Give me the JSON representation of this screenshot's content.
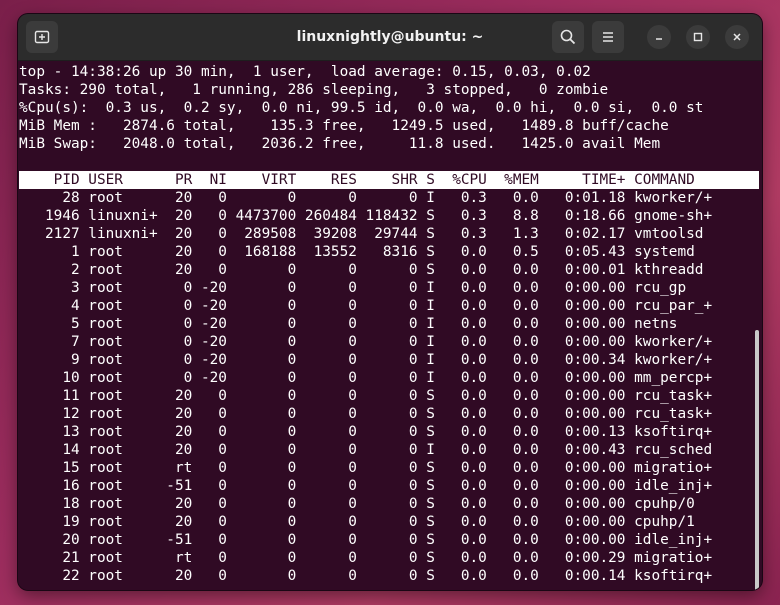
{
  "window": {
    "title": "linuxnightly@ubuntu: ~",
    "icons": {
      "new_tab": "new-tab-icon",
      "search": "search-icon",
      "menu": "hamburger-menu-icon",
      "minimize": "minimize-icon",
      "maximize": "maximize-icon",
      "close": "close-icon"
    }
  },
  "summary": {
    "line1": "top - 14:38:26 up 30 min,  1 user,  load average: 0.15, 0.03, 0.02",
    "line2": "Tasks: 290 total,   1 running, 286 sleeping,   3 stopped,   0 zombie",
    "line3": "%Cpu(s):  0.3 us,  0.2 sy,  0.0 ni, 99.5 id,  0.0 wa,  0.0 hi,  0.0 si,  0.0 st",
    "line4": "MiB Mem :   2874.6 total,    135.3 free,   1249.5 used,   1489.8 buff/cache",
    "line5": "MiB Swap:   2048.0 total,   2036.2 free,     11.8 used.   1425.0 avail Mem"
  },
  "table": {
    "header": "    PID USER      PR  NI    VIRT    RES    SHR S  %CPU  %MEM     TIME+ COMMAND",
    "rows": [
      "     28 root      20   0       0      0      0 I   0.3   0.0   0:01.18 kworker/+",
      "   1946 linuxni+  20   0 4473700 260484 118432 S   0.3   8.8   0:18.66 gnome-sh+",
      "   2127 linuxni+  20   0  289508  39208  29744 S   0.3   1.3   0:02.17 vmtoolsd",
      "      1 root      20   0  168188  13552   8316 S   0.0   0.5   0:05.43 systemd",
      "      2 root      20   0       0      0      0 S   0.0   0.0   0:00.01 kthreadd",
      "      3 root       0 -20       0      0      0 I   0.0   0.0   0:00.00 rcu_gp",
      "      4 root       0 -20       0      0      0 I   0.0   0.0   0:00.00 rcu_par_+",
      "      5 root       0 -20       0      0      0 I   0.0   0.0   0:00.00 netns",
      "      7 root       0 -20       0      0      0 I   0.0   0.0   0:00.00 kworker/+",
      "      9 root       0 -20       0      0      0 I   0.0   0.0   0:00.34 kworker/+",
      "     10 root       0 -20       0      0      0 I   0.0   0.0   0:00.00 mm_percp+",
      "     11 root      20   0       0      0      0 S   0.0   0.0   0:00.00 rcu_task+",
      "     12 root      20   0       0      0      0 S   0.0   0.0   0:00.00 rcu_task+",
      "     13 root      20   0       0      0      0 S   0.0   0.0   0:00.13 ksoftirq+",
      "     14 root      20   0       0      0      0 I   0.0   0.0   0:00.43 rcu_sched",
      "     15 root      rt   0       0      0      0 S   0.0   0.0   0:00.00 migratio+",
      "     16 root     -51   0       0      0      0 S   0.0   0.0   0:00.00 idle_inj+",
      "     18 root      20   0       0      0      0 S   0.0   0.0   0:00.00 cpuhp/0",
      "     19 root      20   0       0      0      0 S   0.0   0.0   0:00.00 cpuhp/1",
      "     20 root     -51   0       0      0      0 S   0.0   0.0   0:00.00 idle_inj+",
      "     21 root      rt   0       0      0      0 S   0.0   0.0   0:00.29 migratio+",
      "     22 root      20   0       0      0      0 S   0.0   0.0   0:00.14 ksoftirq+"
    ]
  },
  "colors": {
    "terminal_bg": "#300a24",
    "titlebar_bg": "#2c2c2c",
    "text": "#ffffff",
    "header_bg": "#ffffff"
  }
}
